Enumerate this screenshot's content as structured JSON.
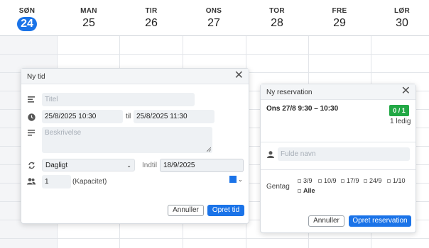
{
  "calendar": {
    "days": [
      {
        "name": "SØN",
        "num": "24",
        "today": true
      },
      {
        "name": "MAN",
        "num": "25"
      },
      {
        "name": "TIR",
        "num": "26"
      },
      {
        "name": "ONS",
        "num": "27"
      },
      {
        "name": "TOR",
        "num": "28"
      },
      {
        "name": "FRE",
        "num": "29"
      },
      {
        "name": "LØR",
        "num": "30"
      }
    ],
    "accent": "#1a73e8"
  },
  "new_time": {
    "title": "Ny tid",
    "title_placeholder": "Titel",
    "start": "25/8/2025  10:30",
    "til_label": "til",
    "end": "25/8/2025  11:30",
    "description_placeholder": "Beskrivelse",
    "repeat_value": "Dagligt",
    "until_label": "Indtil",
    "until_value": "18/9/2025",
    "capacity_value": "1",
    "capacity_label": "(Kapacitet)",
    "color": "#1a73e8",
    "cancel_label": "Annuller",
    "create_label": "Opret tid"
  },
  "new_reservation": {
    "title": "Ny reservation",
    "slot": "Ons 27/8  9:30 – 10:30",
    "badge": "0 / 1",
    "badge_color": "#22a845",
    "free": "1 ledig",
    "name_placeholder": "Fulde navn",
    "repeat_label": "Gentag",
    "dates": [
      "3/9",
      "10/9",
      "17/9",
      "24/9",
      "1/10"
    ],
    "all_label": "Alle",
    "cancel_label": "Annuller",
    "create_label": "Opret reservation"
  }
}
